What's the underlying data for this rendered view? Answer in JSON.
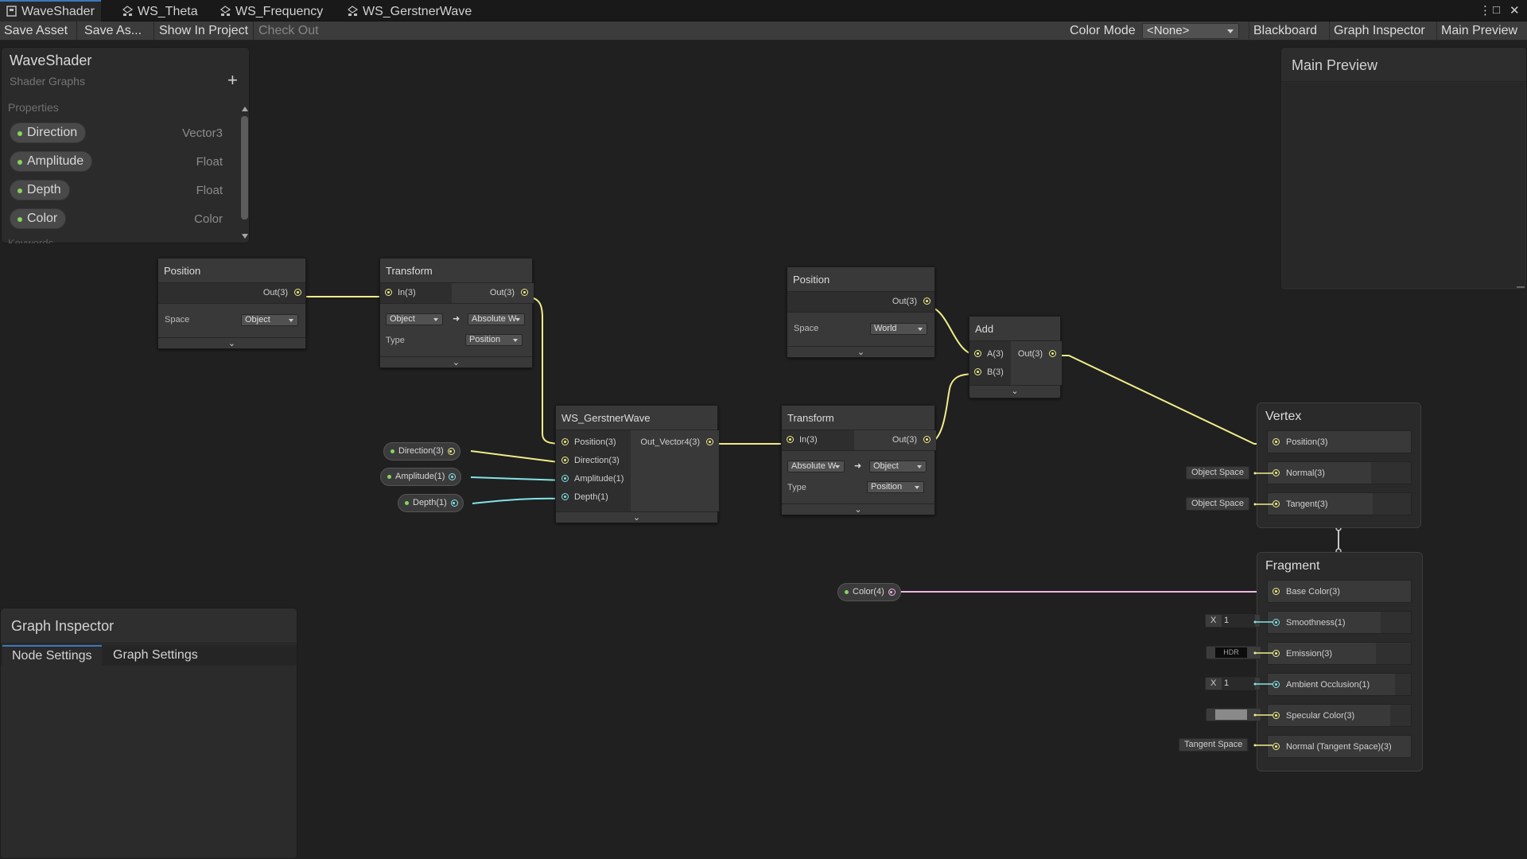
{
  "tabs": [
    {
      "label": "WaveShader",
      "icon": "shader-graph-icon",
      "active": true
    },
    {
      "label": "WS_Theta",
      "icon": "subgraph-icon"
    },
    {
      "label": "WS_Frequency",
      "icon": "subgraph-icon"
    },
    {
      "label": "WS_GerstnerWave",
      "icon": "subgraph-icon"
    }
  ],
  "window_controls": {
    "menu": "⋮",
    "maximize": "□",
    "close": "✕"
  },
  "toolbar": {
    "save_asset": "Save Asset",
    "save_as": "Save As...",
    "show_in_project": "Show In Project",
    "check_out": "Check Out",
    "color_mode_label": "Color Mode",
    "color_mode_value": "<None>",
    "blackboard": "Blackboard",
    "graph_inspector": "Graph Inspector",
    "main_preview": "Main Preview"
  },
  "blackboard": {
    "title": "WaveShader",
    "subtitle": "Shader Graphs",
    "add": "+",
    "section": "Properties",
    "properties": [
      {
        "name": "Direction",
        "type": "Vector3"
      },
      {
        "name": "Amplitude",
        "type": "Float"
      },
      {
        "name": "Depth",
        "type": "Float"
      },
      {
        "name": "Color",
        "type": "Color"
      }
    ],
    "keywords": "Keywords"
  },
  "nodes": {
    "position1": {
      "title": "Position",
      "out": "Out(3)",
      "space_label": "Space",
      "space_value": "Object"
    },
    "transform1": {
      "title": "Transform",
      "in": "In(3)",
      "out": "Out(3)",
      "from": "Object",
      "to": "Absolute W",
      "type_label": "Type",
      "type_value": "Position"
    },
    "position2": {
      "title": "Position",
      "out": "Out(3)",
      "space_label": "Space",
      "space_value": "World"
    },
    "add": {
      "title": "Add",
      "a": "A(3)",
      "b": "B(3)",
      "out": "Out(3)"
    },
    "gerstner": {
      "title": "WS_GerstnerWave",
      "in1": "Position(3)",
      "in2": "Direction(3)",
      "in3": "Amplitude(1)",
      "in4": "Depth(1)",
      "out": "Out_Vector4(3)"
    },
    "transform2": {
      "title": "Transform",
      "in": "In(3)",
      "out": "Out(3)",
      "from": "Absolute W",
      "to": "Object",
      "type_label": "Type",
      "type_value": "Position"
    }
  },
  "property_nodes": {
    "direction": "Direction(3)",
    "amplitude": "Amplitude(1)",
    "depth": "Depth(1)",
    "color": "Color(4)"
  },
  "vertex": {
    "title": "Vertex",
    "blocks": [
      "Position(3)",
      "Normal(3)",
      "Tangent(3)"
    ],
    "normal_space": "Object Space",
    "tangent_space": "Object Space"
  },
  "fragment": {
    "title": "Fragment",
    "blocks": [
      "Base Color(3)",
      "Smoothness(1)",
      "Emission(3)",
      "Ambient Occlusion(1)",
      "Specular Color(3)",
      "Normal (Tangent Space)(3)"
    ],
    "smoothness_label": "X",
    "smoothness_value": "1",
    "emission_label": "HDR",
    "ao_label": "X",
    "ao_value": "1",
    "specular_swatch": "#8a8a8a",
    "normal_space": "Tangent Space"
  },
  "main_preview": {
    "title": "Main Preview"
  },
  "graph_inspector": {
    "title": "Graph Inspector",
    "tabs": [
      "Node Settings",
      "Graph Settings"
    ]
  },
  "colors": {
    "vector_wire": "#f0ec8b",
    "float_wire": "#84e4e7",
    "color_wire": "#f2b7e9",
    "accent": "#3a79bb"
  }
}
